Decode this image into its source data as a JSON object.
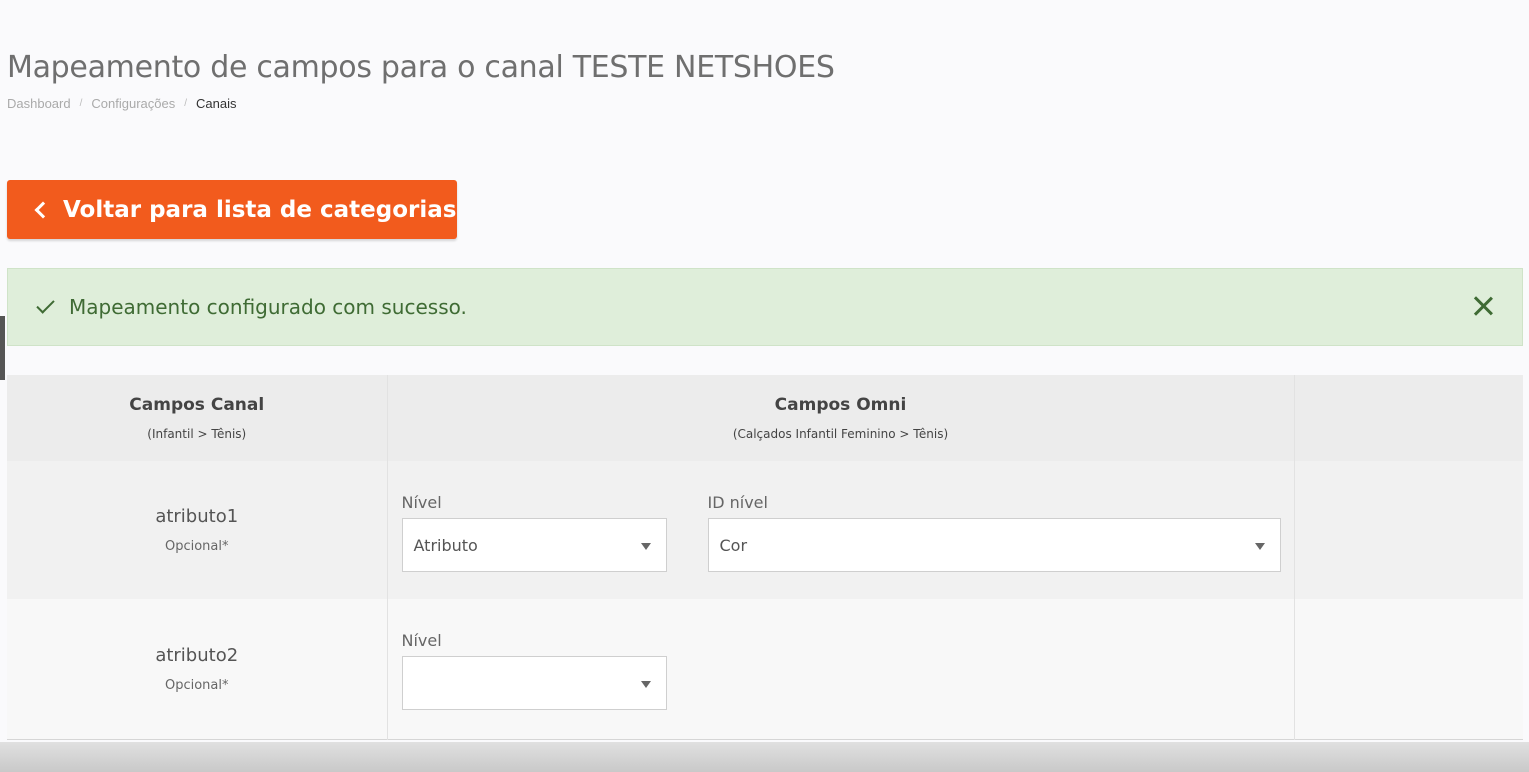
{
  "page": {
    "title": "Mapeamento de campos para o canal TESTE NETSHOES"
  },
  "breadcrumb": {
    "items": [
      "Dashboard",
      "Configurações",
      "Canais"
    ],
    "separator": "/"
  },
  "back_button": {
    "label": "Voltar para lista de categorias",
    "icon": "chevron-left-icon",
    "color": "#f25b1d"
  },
  "alert": {
    "message": "Mapeamento configurado com sucesso.",
    "icon": "check-icon",
    "close_icon": "close-icon",
    "background": "#dfeeda",
    "text_color": "#3f6b34"
  },
  "table": {
    "headers": [
      {
        "title": "Campos Canal",
        "subtitle": "(Infantil > Tênis)"
      },
      {
        "title": "Campos Omni",
        "subtitle": "(Calçados Infantil Feminino > Tênis)"
      },
      {
        "title": "",
        "subtitle": ""
      }
    ],
    "rows": [
      {
        "field": "atributo1",
        "required_label": "Opcional*",
        "nivel_label": "Nível",
        "nivel_value": "Atributo",
        "id_nivel_label": "ID nível",
        "id_nivel_value": "Cor"
      },
      {
        "field": "atributo2",
        "required_label": "Opcional*",
        "nivel_label": "Nível",
        "nivel_value": ""
      }
    ]
  }
}
